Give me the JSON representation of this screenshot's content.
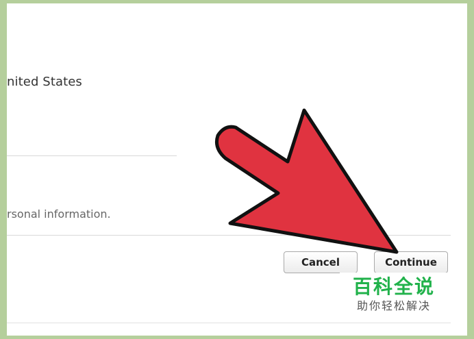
{
  "form": {
    "country_text": "nited States",
    "privacy_text": "rsonal information."
  },
  "buttons": {
    "cancel_label": "Cancel",
    "continue_label": "Continue"
  },
  "overlay": {
    "arrow_color": "#e03340",
    "arrow_icon": "pointer-arrow-icon"
  },
  "watermark": {
    "title": "百科全说",
    "subtitle": "助你轻松解决"
  }
}
